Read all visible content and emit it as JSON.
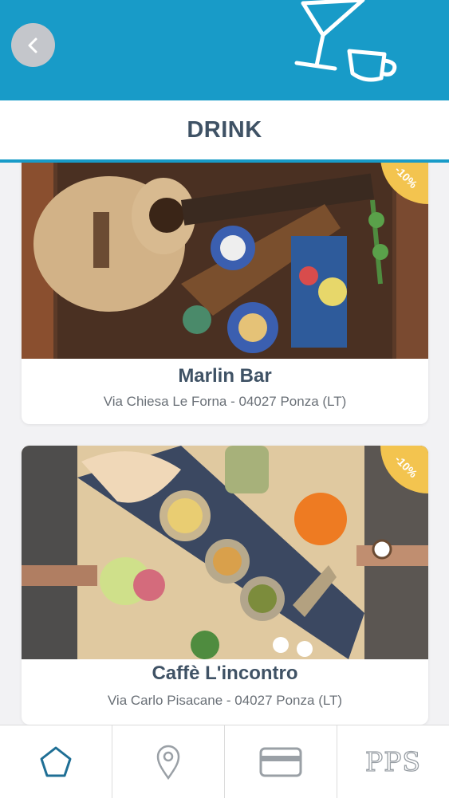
{
  "header": {
    "back_icon": "chevron-left-icon",
    "art_icons": [
      "cocktail-glass-icon",
      "coffee-cup-icon"
    ]
  },
  "title": "DRINK",
  "venues": [
    {
      "name": "Marlin Bar",
      "address": "Via Chiesa Le Forna - 04027 Ponza (LT)",
      "discount": "-10%"
    },
    {
      "name": "Caffè L'incontro",
      "address": "Via Carlo Pisacane - 04027 Ponza (LT)",
      "discount": "-10%"
    }
  ],
  "tabs": [
    {
      "icon": "home-icon",
      "active": true
    },
    {
      "icon": "map-pin-icon",
      "active": false
    },
    {
      "icon": "credit-card-icon",
      "active": false
    },
    {
      "icon": "pps-logo",
      "label": "PPS",
      "active": false
    }
  ],
  "colors": {
    "brand_blue": "#189bc8",
    "title_text": "#3f5265",
    "badge_yellow": "#f3c44f",
    "tab_active": "#1f6f95",
    "tab_inactive": "#9aa0a6"
  }
}
